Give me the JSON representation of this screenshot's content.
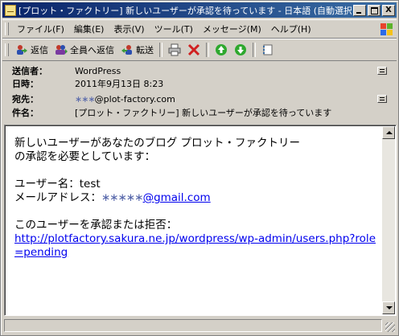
{
  "window": {
    "title": "[プロット・ファクトリー] 新しいユーザーが承認を待っています - 日本語 (自動選択)",
    "buttons": {
      "minimize": "_",
      "maximize": "□",
      "close": "X"
    }
  },
  "menu": [
    "ファイル(F)",
    "編集(E)",
    "表示(V)",
    "ツール(T)",
    "メッセージ(M)",
    "ヘルプ(H)"
  ],
  "toolbar": {
    "reply": "返信",
    "reply_all": "全員へ返信",
    "forward": "転送"
  },
  "headers": {
    "from_label": "送信者：",
    "from_value": "WordPress",
    "date_label": "日時：",
    "date_value": "2011年9月13日 8:23",
    "to_label": "宛先：",
    "to_value_obscured": "∗∗∗",
    "to_value": "@plot-factory.com",
    "subject_label": "件名：",
    "subject_value": "[プロット・ファクトリー] 新しいユーザーが承認を待っています"
  },
  "message": {
    "line1": "新しいユーザーがあなたのブログ プロット・ファクトリー",
    "line2": "の承認を必要としています：",
    "username": "ユーザー名：test",
    "email_label": "メールアドレス：",
    "email_obscured": "∗∗∗∗∗",
    "email_domain": "@gmail.com",
    "approve_text": "このユーザーを承認または拒否：",
    "approve_link": "http://plotfactory.sakura.ne.jp/wordpress/wp-admin/users.php?role=pending"
  },
  "colors": {
    "titlebar_start": "#0a246a",
    "titlebar_end": "#3a6ea5",
    "link": "#0000ee"
  }
}
